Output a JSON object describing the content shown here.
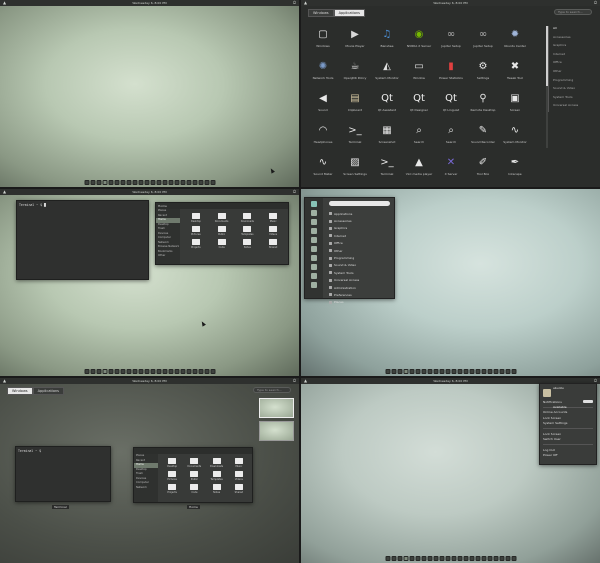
{
  "topbar": {
    "activities": "▲",
    "clock": "Wednesday 6, 8:00 PM",
    "power": "⏻"
  },
  "pane2": {
    "tabs": [
      "Windows",
      "Applications"
    ],
    "search_placeholder": "Type to search...",
    "apps": [
      {
        "label": "Windows",
        "icon": "window-icon",
        "glyph": "▢",
        "color": "#e8e8e8"
      },
      {
        "label": "Movie Player",
        "icon": "movie-player-icon",
        "glyph": "▶",
        "color": "#d8d8d8"
      },
      {
        "label": "Banshee",
        "icon": "music-icon",
        "glyph": "♫",
        "color": "#4c8fd6"
      },
      {
        "label": "NVIDIA X Server",
        "icon": "nvidia-icon",
        "glyph": "◉",
        "color": "#76b900"
      },
      {
        "label": "Jupiter Setup",
        "icon": "jupiter-icon",
        "glyph": "∞",
        "color": "#b0b0b0"
      },
      {
        "label": "Jupiter Setup",
        "icon": "jupiter-icon",
        "glyph": "∞",
        "color": "#b0b0b0"
      },
      {
        "label": "Ubuntu Center",
        "icon": "sparkle-icon",
        "glyph": "✹",
        "color": "#9fb4d8"
      },
      {
        "label": "Network Tools",
        "icon": "network-icon",
        "glyph": "✺",
        "color": "#7a9ac8"
      },
      {
        "label": "OpenJDK Policy",
        "icon": "java-icon",
        "glyph": "☕",
        "color": "#e0e0e0"
      },
      {
        "label": "System Monitor",
        "icon": "monitor-icon",
        "glyph": "◭",
        "color": "#e0e0e0"
      },
      {
        "label": "Window",
        "icon": "window-icon",
        "glyph": "▭",
        "color": "#e0e0e0"
      },
      {
        "label": "Power Statistics",
        "icon": "chart-icon",
        "glyph": "▮",
        "color": "#e04040"
      },
      {
        "label": "Settings",
        "icon": "gear-icon",
        "glyph": "⚙",
        "color": "#e8e8e8"
      },
      {
        "label": "Tweak Tool",
        "icon": "tools-icon",
        "glyph": "✖",
        "color": "#e8e8e8"
      },
      {
        "label": "Sound",
        "icon": "speaker-icon",
        "glyph": "◀",
        "color": "#e8e8e8"
      },
      {
        "label": "Clipboard",
        "icon": "clipboard-icon",
        "glyph": "▤",
        "color": "#d6c7a2"
      },
      {
        "label": "Qt Assistant",
        "icon": "qt-icon",
        "glyph": "Qt",
        "color": "#f0f0f0"
      },
      {
        "label": "Qt Designer",
        "icon": "qt-icon",
        "glyph": "Qt",
        "color": "#f0f0f0"
      },
      {
        "label": "Qt Linguist",
        "icon": "qt-icon",
        "glyph": "Qt",
        "color": "#f0f0f0"
      },
      {
        "label": "Remote Desktop",
        "icon": "satellite-icon",
        "glyph": "⚲",
        "color": "#e8e8e8"
      },
      {
        "label": "Screen",
        "icon": "display-icon",
        "glyph": "▣",
        "color": "#e8e8e8"
      },
      {
        "label": "Headphones",
        "icon": "headphones-icon",
        "glyph": "◠",
        "color": "#e8e8e8"
      },
      {
        "label": "Terminal",
        "icon": "terminal-icon",
        "glyph": ">_",
        "color": "#e8e8e8"
      },
      {
        "label": "Screenshot",
        "icon": "screenshot-icon",
        "glyph": "▦",
        "color": "#e8e8e8"
      },
      {
        "label": "Search",
        "icon": "search-icon",
        "glyph": "⌕",
        "color": "#e8e8e8"
      },
      {
        "label": "Search",
        "icon": "search-icon",
        "glyph": "⌕",
        "color": "#e8e8e8"
      },
      {
        "label": "Sound Recorder",
        "icon": "microphone-icon",
        "glyph": "✎",
        "color": "#e8e8e8"
      },
      {
        "label": "System Monitor",
        "icon": "pulse-icon",
        "glyph": "∿",
        "color": "#e8e8e8"
      },
      {
        "label": "Sound Meter",
        "icon": "pulse-icon",
        "glyph": "∿",
        "color": "#e8e8e8"
      },
      {
        "label": "Screen Settings",
        "icon": "settings-window-icon",
        "glyph": "▨",
        "color": "#e8e8e8"
      },
      {
        "label": "Terminal",
        "icon": "terminal-icon",
        "glyph": ">_",
        "color": "#e8e8e8"
      },
      {
        "label": "VLC media player",
        "icon": "vlc-icon",
        "glyph": "▲",
        "color": "#e8e8e8"
      },
      {
        "label": "X Server",
        "icon": "x-icon",
        "glyph": "✕",
        "color": "#7a6ad8"
      },
      {
        "label": "Tool Box",
        "icon": "wrench-icon",
        "glyph": "✐",
        "color": "#e8e8e8"
      },
      {
        "label": "Inkscape",
        "icon": "pen-icon",
        "glyph": "✒",
        "color": "#e8e8e8"
      }
    ],
    "categories": [
      "All",
      "Accessories",
      "Graphics",
      "Internet",
      "Office",
      "Other",
      "Programming",
      "Sound & Video",
      "System Tools",
      "Universal Access"
    ]
  },
  "pane3": {
    "terminal_title": "Terminal",
    "terminal_prompt": "Terminal ~ $ █",
    "files_title": "Home",
    "sidebar": [
      "Places",
      "Recent",
      "Home",
      "Desktop",
      "Trash",
      "Devices",
      "Computer",
      "Network",
      "Browse Network",
      "Bookmarks",
      "Other"
    ],
    "files": [
      "Desktop",
      "Documents",
      "Downloads",
      "Music",
      "Pictures",
      "Public",
      "Templates",
      "Videos",
      "Projects",
      "Code",
      "Notes",
      "Shared"
    ]
  },
  "pane4": {
    "menu_items": [
      "Applications",
      "Accessories",
      "Graphics",
      "Internet",
      "Office",
      "Other",
      "Programming",
      "Sound & Video",
      "System Tools",
      "Universal Access",
      "Administration",
      "Preferences",
      "Places"
    ]
  },
  "pane5": {
    "tabs": [
      "Windows",
      "Applications"
    ],
    "search_placeholder": "Type to search...",
    "terminal_prompt": "Terminal ~ $",
    "terminal_caption": "Terminal",
    "files_caption": "Home",
    "sidebar": [
      "Places",
      "Recent",
      "Home",
      "Desktop",
      "Trash",
      "Devices",
      "Computer",
      "Network"
    ],
    "files": [
      "Desktop",
      "Documents",
      "Downloads",
      "Music",
      "Pictures",
      "Public",
      "Templates",
      "Videos",
      "Projects",
      "Code",
      "Notes",
      "Shared"
    ]
  },
  "pane6": {
    "user": "ubuntu",
    "status": "Available",
    "notifications": "Notifications",
    "notifications_state": "ON",
    "links": [
      "Online Accounts",
      "Lock Screen",
      "System Settings",
      "Lock Screen",
      "Switch User",
      "Log Out",
      "Power Off"
    ]
  }
}
